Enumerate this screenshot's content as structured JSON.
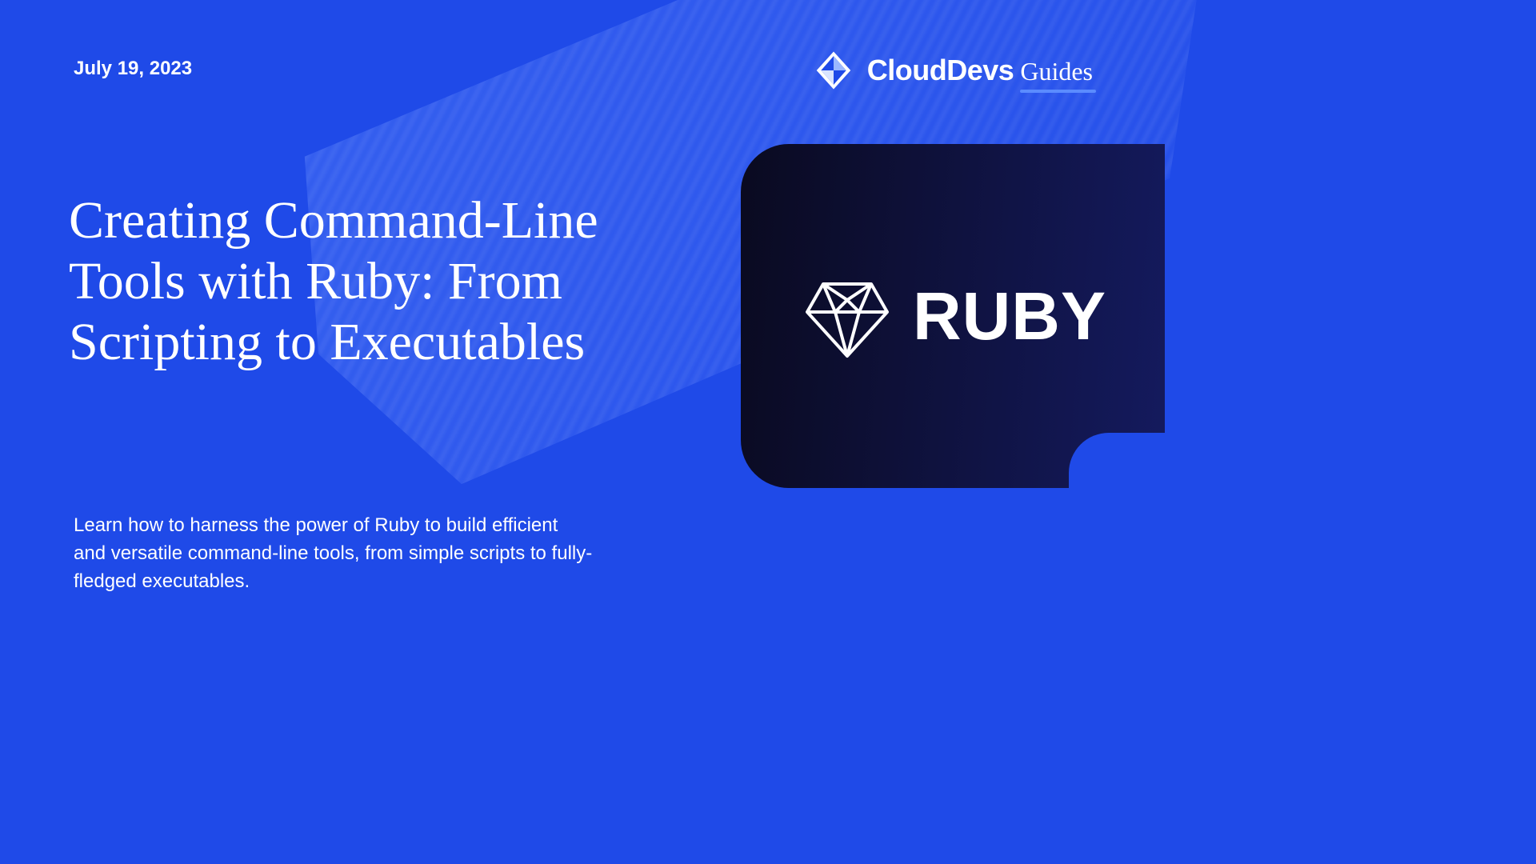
{
  "date": "July 19, 2023",
  "brand": {
    "main": "CloudDevs",
    "sub": "Guides"
  },
  "title": "Creating Command-Line Tools with Ruby: From Scripting to Executables",
  "subtitle": "Learn how to harness the power of Ruby to build efficient and versatile command-line tools, from simple scripts to fully-fledged executables.",
  "card": {
    "label": "RUBY"
  }
}
